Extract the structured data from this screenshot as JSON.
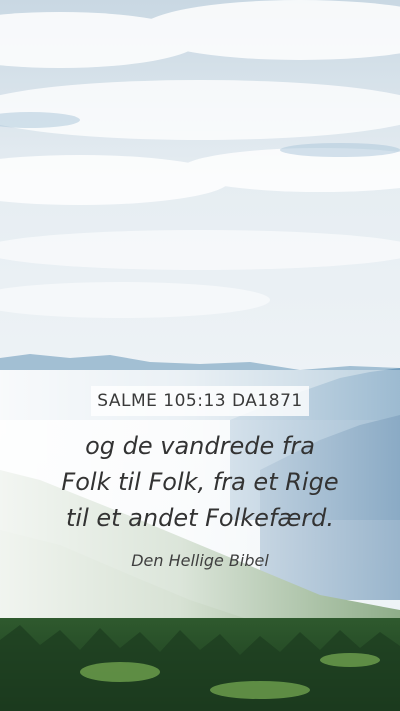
{
  "reference": {
    "text": "SALME 105:13  DA1871"
  },
  "verse": {
    "lines": [
      "og de vandrede fra",
      "Folk til Folk, fra et Rige",
      "til et andet Folkefærd."
    ]
  },
  "source": {
    "text": "Den Hellige Bibel"
  },
  "colors": {
    "sky": "#dfe9ee",
    "mountain_blue": "#6a96b8",
    "forest_green": "#2f5a2e",
    "text": "#333333"
  }
}
